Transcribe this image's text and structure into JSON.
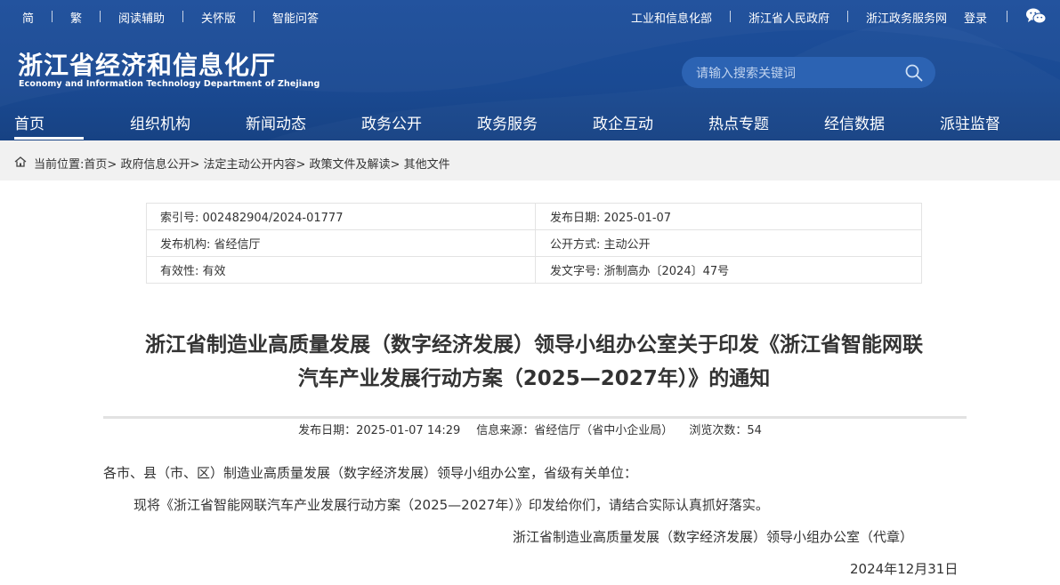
{
  "topbar": {
    "left": [
      "简",
      "繁",
      "阅读辅助",
      "关怀版",
      "智能问答"
    ],
    "right": [
      "工业和信息化部",
      "浙江省人民政府",
      "浙江政务服务网"
    ],
    "login": "登录"
  },
  "logo": {
    "cn": "浙江省经济和信息化厅",
    "en": "Economy and Information Technology Department of Zhejiang"
  },
  "search": {
    "placeholder": "请输入搜索关键词"
  },
  "nav": [
    "首页",
    "组织机构",
    "新闻动态",
    "政务公开",
    "政务服务",
    "政企互动",
    "热点专题",
    "经信数据",
    "派驻监督"
  ],
  "breadcrumb": {
    "prefix": "当前位置:",
    "items": [
      "首页",
      "政府信息公开",
      "法定主动公开内容",
      "政策文件及解读",
      "其他文件"
    ]
  },
  "meta": {
    "index_no": "索引号: 002482904/2024-01777",
    "publish_date": "发布日期: 2025-01-07",
    "publisher": "发布机构: 省经信厅",
    "disclosure": "公开方式: 主动公开",
    "validity": "有效性: 有效",
    "doc_no": "发文字号: 浙制高办〔2024〕47号"
  },
  "article": {
    "title_line1": "浙江省制造业高质量发展（数字经济发展）领导小组办公室关于印发《浙江省智能网联",
    "title_line2": "汽车产业发展行动方案（2025—2027年）》的通知",
    "info_date": "发布日期：2025-01-07 14:29",
    "info_source": "信息来源：省经信厅（省中小企业局）",
    "info_views": "浏览次数：54",
    "p1": "各市、县（市、区）制造业高质量发展（数字经济发展）领导小组办公室，省级有关单位：",
    "p2": "现将《浙江省智能网联汽车产业发展行动方案（2025—2027年）》印发给你们，请结合实际认真抓好落实。",
    "signature": "浙江省制造业高质量发展（数字经济发展）领导小组办公室（代章）",
    "date": "2024年12月31日"
  },
  "colors": {
    "header_bg": "#1a4a93",
    "search_bg": "#2c63b3",
    "breadcrumb_bg": "#f1f1f1",
    "rule": "#e2e2e2"
  },
  "icons": [
    "wechat-icon",
    "search-icon",
    "home-icon"
  ]
}
